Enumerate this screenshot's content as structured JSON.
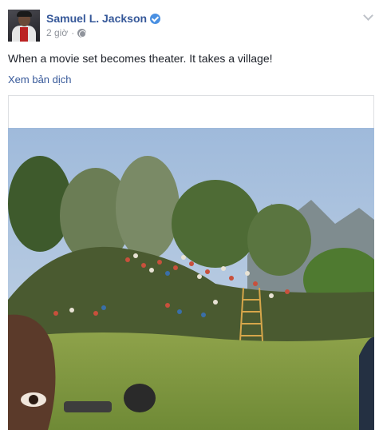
{
  "post": {
    "author": "Samuel L. Jackson",
    "timestamp": "2 giờ",
    "separator": "·",
    "text": "When a movie set becomes theater. It takes a village!",
    "translate_label": "Xem bản dịch"
  },
  "icons": {
    "verified": "verified-badge-icon",
    "privacy": "globe-icon",
    "menu": "chevron-down-icon"
  },
  "colors": {
    "link": "#365899",
    "meta": "#90949c",
    "verified": "#4a90e2"
  }
}
